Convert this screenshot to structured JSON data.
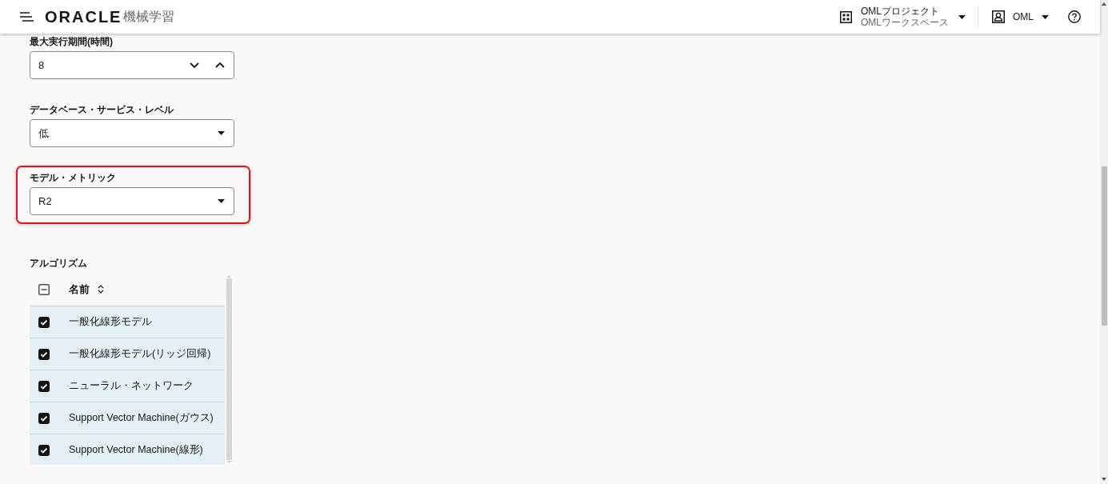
{
  "header": {
    "brand": "ORACLE",
    "product": "機械学習",
    "project": {
      "name": "OMLプロジェクト",
      "workspace": "OMLワークスペース"
    },
    "user": "OML"
  },
  "form": {
    "fields": [
      {
        "kind": "spinner",
        "label": "最大実行期間(時間)",
        "value": "8",
        "highlighted": false
      },
      {
        "kind": "select",
        "label": "データベース・サービス・レベル",
        "value": "低",
        "highlighted": false
      },
      {
        "kind": "select",
        "label": "モデル・メトリック",
        "value": "R2",
        "highlighted": true
      }
    ]
  },
  "algorithms": {
    "title": "アルゴリズム",
    "select_all": {
      "indeterminate": true
    },
    "column": {
      "label": "名前"
    },
    "rows": [
      {
        "name": "一般化線形モデル",
        "checked": true,
        "selected": true
      },
      {
        "name": "一般化線形モデル(リッジ回帰)",
        "checked": true,
        "selected": true
      },
      {
        "name": "ニューラル・ネットワーク",
        "checked": true,
        "selected": true
      },
      {
        "name": "Support Vector Machine(ガウス)",
        "checked": true,
        "selected": true
      },
      {
        "name": "Support Vector Machine(線形)",
        "checked": true,
        "selected": true
      }
    ]
  }
}
